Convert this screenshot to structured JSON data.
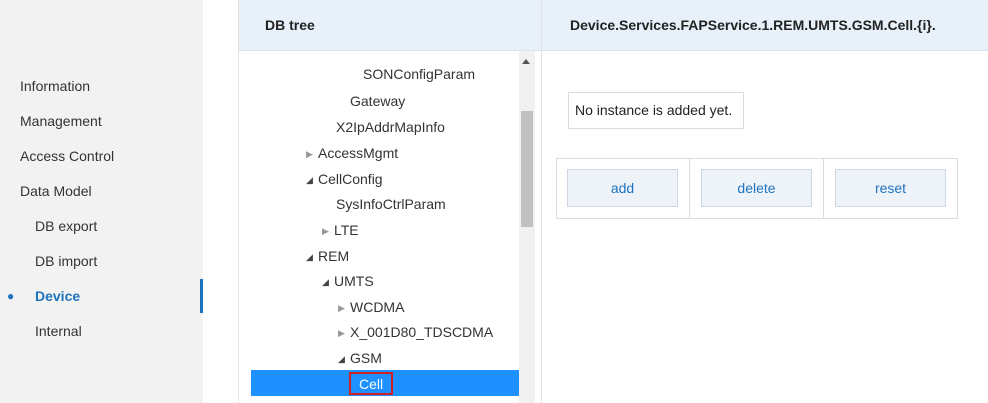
{
  "sidebar": {
    "items": [
      {
        "label": "Information"
      },
      {
        "label": "Management"
      },
      {
        "label": "Access Control"
      },
      {
        "label": "Data Model"
      },
      {
        "label": "DB export"
      },
      {
        "label": "DB import"
      },
      {
        "label": "Device"
      },
      {
        "label": "Internal"
      }
    ]
  },
  "tree": {
    "header": "DB tree",
    "nodes": [
      {
        "label": "SONConfigParam"
      },
      {
        "label": "Gateway"
      },
      {
        "label": "X2IpAddrMapInfo"
      },
      {
        "label": "AccessMgmt"
      },
      {
        "label": "CellConfig"
      },
      {
        "label": "SysInfoCtrlParam"
      },
      {
        "label": "LTE"
      },
      {
        "label": "REM"
      },
      {
        "label": "UMTS"
      },
      {
        "label": "WCDMA"
      },
      {
        "label": "X_001D80_TDSCDMA"
      },
      {
        "label": "GSM"
      },
      {
        "label": "Cell"
      }
    ]
  },
  "detail": {
    "header": "Device.Services.FAPService.1.REM.UMTS.GSM.Cell.{i}.",
    "notice": "No instance is added yet.",
    "buttons": {
      "add": "add",
      "delete": "delete",
      "reset": "reset"
    }
  },
  "icons": {
    "collapsed": "triangle-right-icon",
    "expanded": "triangle-down-icon"
  },
  "colors": {
    "accent": "#1e73be",
    "selection": "#1e90ff",
    "selection_outline": "#d02020",
    "header_bg": "#e8f1f9",
    "sidebar_bg": "#f2f2f2"
  }
}
